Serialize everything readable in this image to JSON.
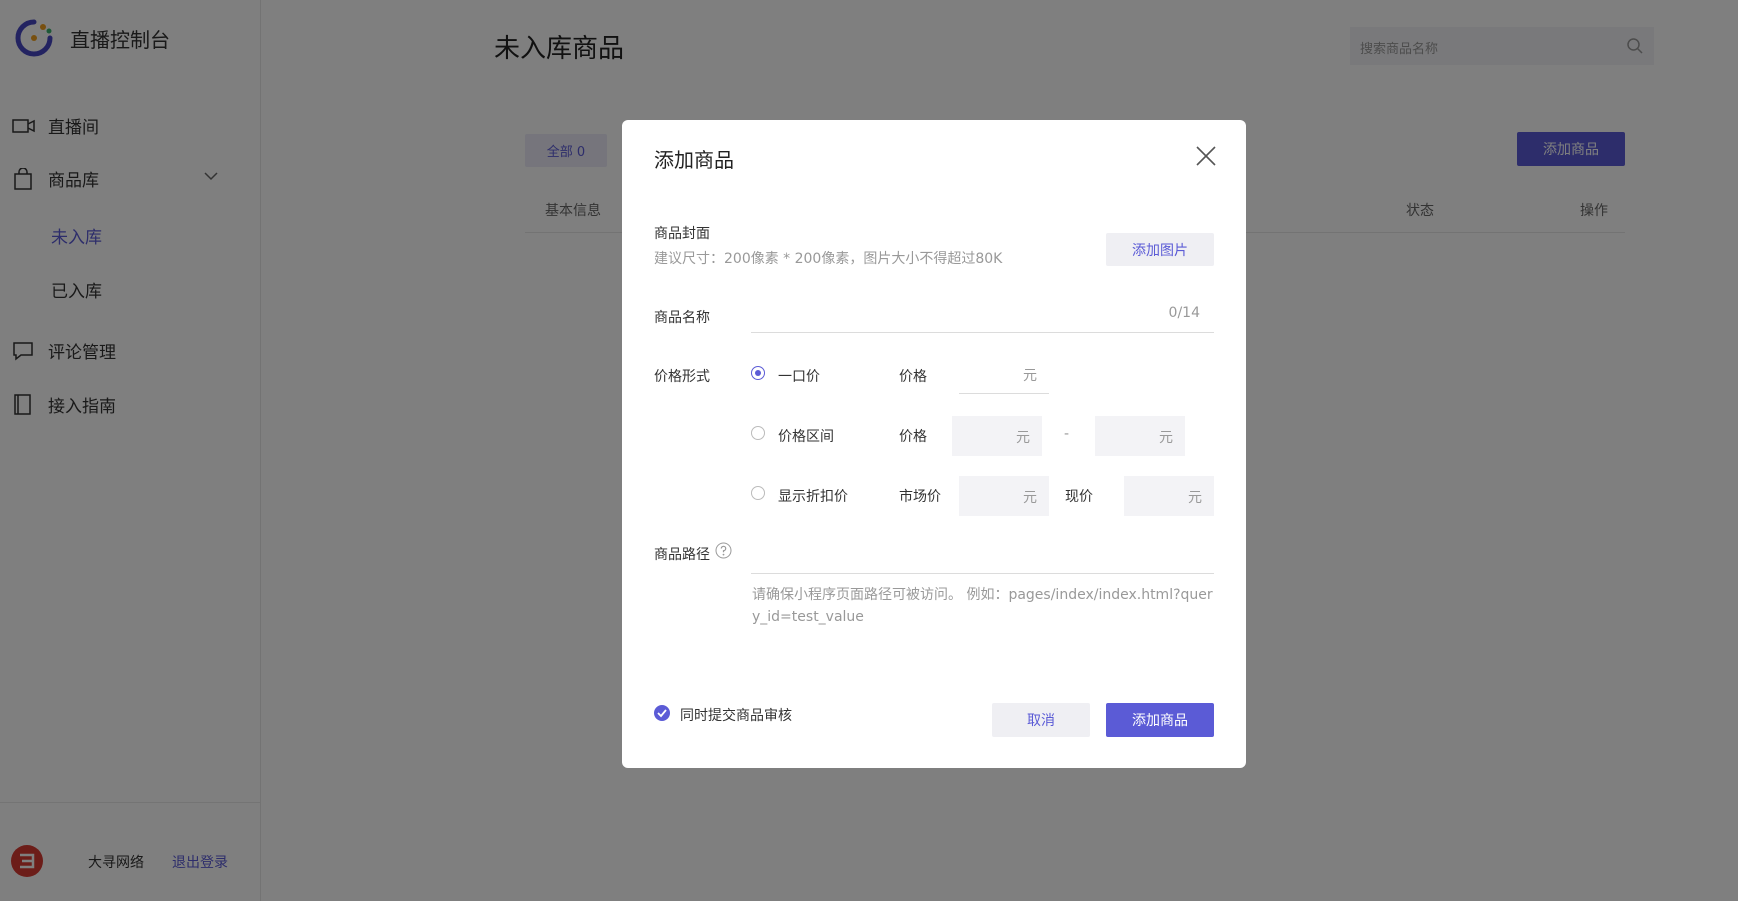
{
  "app": {
    "title": "直播控制台"
  },
  "sidebar": {
    "items": [
      {
        "label": "直播间",
        "icon": "video-camera-icon"
      },
      {
        "label": "商品库",
        "icon": "shopping-bag-icon"
      },
      {
        "label": "评论管理",
        "icon": "comment-icon"
      },
      {
        "label": "接入指南",
        "icon": "book-icon"
      }
    ],
    "sub_items": [
      {
        "label": "未入库",
        "active": true
      },
      {
        "label": "已入库",
        "active": false
      }
    ],
    "footer": {
      "org_name": "大寻网络",
      "logout_label": "退出登录"
    }
  },
  "main": {
    "page_title": "未入库商品",
    "search_placeholder": "搜索商品名称",
    "tab_all": "全部 0",
    "add_button": "添加商品",
    "columns": [
      "基本信息",
      "状态",
      "操作"
    ]
  },
  "modal": {
    "title": "添加商品",
    "cover_label": "商品封面",
    "cover_hint": "建议尺寸：200像素 * 200像素，图片大小不得超过80K",
    "add_image_button": "添加图片",
    "name_label": "商品名称",
    "name_counter": "0/14",
    "price_type_label": "价格形式",
    "options": [
      {
        "label": "一口价",
        "selected": true
      },
      {
        "label": "价格区间",
        "selected": false
      },
      {
        "label": "显示折扣价",
        "selected": false
      }
    ],
    "price_label": "价格",
    "market_price_label": "市场价",
    "current_price_label": "现价",
    "unit": "元",
    "range_separator": "-",
    "path_label": "商品路径",
    "path_hint": "请确保小程序页面路径可被访问。 例如：pages/index/index.html?query_id=test_value",
    "submit_audit_label": "同时提交商品审核",
    "cancel_button": "取消",
    "confirm_button": "添加商品"
  },
  "colors": {
    "accent": "#5b5bd6",
    "overlay": "rgba(0,0,0,0.5)",
    "logo_red": "#d93a32"
  }
}
